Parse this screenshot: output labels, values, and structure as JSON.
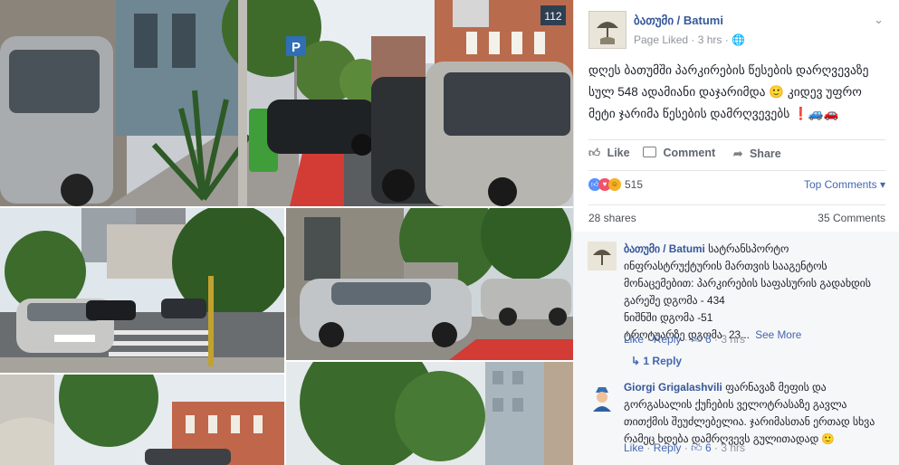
{
  "page": {
    "name": "ბათუმი / Batumi",
    "meta": "Page Liked · 3 hrs · 🌐",
    "chevron": "⌄"
  },
  "post": {
    "text": "დღეს ბათუმში პარკირების წესების დარღვევაზე სულ 548 ადამიანი დაჯარიმდა 🙂 კიდევ უფრო მეტი ჯარიმა წესების დამრღვევებს ❗🚙🚗"
  },
  "actions": {
    "like": "Like",
    "comment": "Comment",
    "share": "Share"
  },
  "reactions": {
    "count": "515",
    "top_comments": "Top Comments ▾"
  },
  "stats": {
    "shares": "28 shares",
    "comments": "35 Comments"
  },
  "comments": [
    {
      "author": "ბათუმი / Batumi",
      "text": "სატრანსპორტო ინფრასტრუქტურის მართვის სააგენტოს მონაცემებით: პარკირების საფასურის გადახდის გარეშე დგომა - 434",
      "line2": "ნიშნში დგომა -51",
      "line3": "ტროტუარზე დგომა- 23...",
      "see_more": "See More",
      "like": "Like",
      "reply": "Reply",
      "likes": "6",
      "time": "3 hrs"
    },
    {
      "author": "Giorgi Grigalashvili",
      "text": "ფარნავაზ მეფის და გორგასალის ქუჩების ველოტრასაზე გავლა თითქმის შეუძლებელია. ჯარიმასთან ერთად სხვა რამეც ხდება დამრღვევს გულითადად 🙂",
      "like": "Like",
      "reply": "Reply",
      "likes": "6",
      "time": "3 hrs"
    }
  ],
  "replies_link": "↳ 1 Reply",
  "signs": {
    "parking": "P",
    "house_number": "112"
  },
  "colors": {
    "link": "#365899",
    "accent": "#4267b2",
    "like_blue": "#5890ff",
    "love_red": "#f25268",
    "haha_yellow": "#f7b125",
    "bike_lane": "#d33b35"
  }
}
